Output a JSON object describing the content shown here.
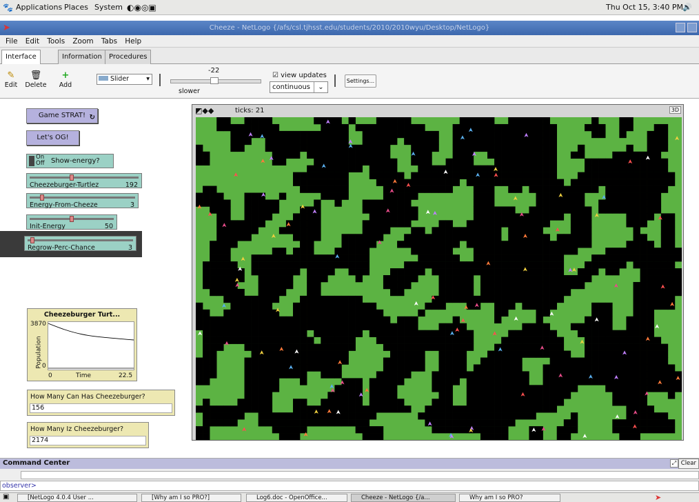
{
  "desktop_panel": {
    "items": [
      "Applications",
      "Places",
      "System"
    ],
    "clock": "Thu Oct 15,  3:40 PM"
  },
  "window": {
    "title": "Cheeze - NetLogo {/afs/csl.tjhsst.edu/students/2010/2010wyu/Desktop/NetLogo}"
  },
  "menubar": {
    "items": [
      "File",
      "Edit",
      "Tools",
      "Zoom",
      "Tabs",
      "Help"
    ]
  },
  "tabs": {
    "items": [
      "Interface",
      "Information",
      "Procedures"
    ]
  },
  "toolbar": {
    "edit": "Edit",
    "delete": "Delete",
    "add": "Add",
    "widget_select": "Slider",
    "speed_value": "-22",
    "speed_label": "slower",
    "view_updates": "view updates",
    "update_mode": "continuous",
    "settings": "Settings..."
  },
  "widgets": {
    "game_button": "Game STRAT!",
    "lets_go_button": "Let's OG!",
    "show_energy": {
      "on": "On",
      "off": "Off",
      "label": "Show-energy?"
    },
    "sliders": [
      {
        "label": "Cheezeburger-Turtlez",
        "value": "192",
        "fraction": 0.38
      },
      {
        "label": "Energy-From-Cheeze",
        "value": "3",
        "fraction": 0.1
      },
      {
        "label": "Init-Energy",
        "value": "50",
        "fraction": 0.5
      },
      {
        "label": "Regrow-Perc-Chance",
        "value": "3",
        "fraction": 0.03
      }
    ]
  },
  "plot": {
    "title": "Cheezeburger Turt...",
    "ymax": "3870",
    "ymin": "0",
    "xmin": "0",
    "xmax": "22.5",
    "xlabel": "Time",
    "ylabel": "Population"
  },
  "monitors": {
    "items": [
      {
        "label": "How Many Can Has Cheezeburger?",
        "value": "156"
      },
      {
        "label": "How Many Iz Cheezeburger?",
        "value": "2174"
      }
    ]
  },
  "view": {
    "ticks": "ticks: 21",
    "btn_3d": "3D",
    "patch_grid": {
      "cols": 70,
      "rows": 47,
      "green_fraction": 0.64
    }
  },
  "command_center": {
    "title": "Command Center",
    "clear": "Clear",
    "prompt": "observer>",
    "input_value": ""
  },
  "taskbar": {
    "items": [
      "[NetLogo 4.0.4 User ...",
      "[Why am I so PRO?]",
      "Log6.doc - OpenOffice...",
      "Cheeze - NetLogo {/a...",
      "Why am I so PRO?"
    ]
  }
}
